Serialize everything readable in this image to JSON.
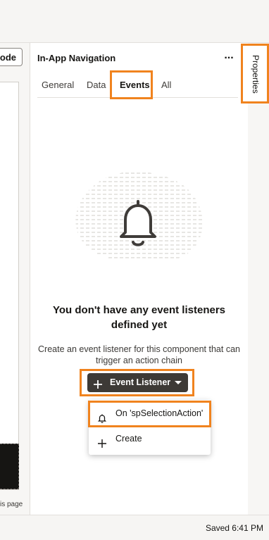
{
  "left_pane": {
    "code_button_fragment": "ode",
    "footer_fragment": "is page"
  },
  "panel": {
    "title": "In-App Navigation",
    "more_label": "...",
    "tabs": [
      {
        "label": "General",
        "active": false
      },
      {
        "label": "Data",
        "active": false
      },
      {
        "label": "Events",
        "active": true
      },
      {
        "label": "All",
        "active": false
      }
    ],
    "empty_state": {
      "illustration_icon": "bell-icon",
      "title_line1": "You don't have any event listeners",
      "title_line2": "defined yet",
      "desc_line1": "Create an event listener for this component that can",
      "desc_line2": "trigger an action chain"
    },
    "event_listener_button": {
      "label": "Event Listener",
      "icon": "plus-icon",
      "menu_icon": "caret-down-icon"
    },
    "dropdown_menu": [
      {
        "label": "On 'spSelectionAction'",
        "icon": "bell-icon"
      },
      {
        "label": "Create",
        "icon": "plus-icon"
      }
    ]
  },
  "side_tab": {
    "label": "Properties"
  },
  "status": {
    "saved": "Saved 6:41 PM"
  },
  "colors": {
    "highlight": "#f0831e",
    "button_dark": "#3d3a36",
    "text": "#161513"
  }
}
